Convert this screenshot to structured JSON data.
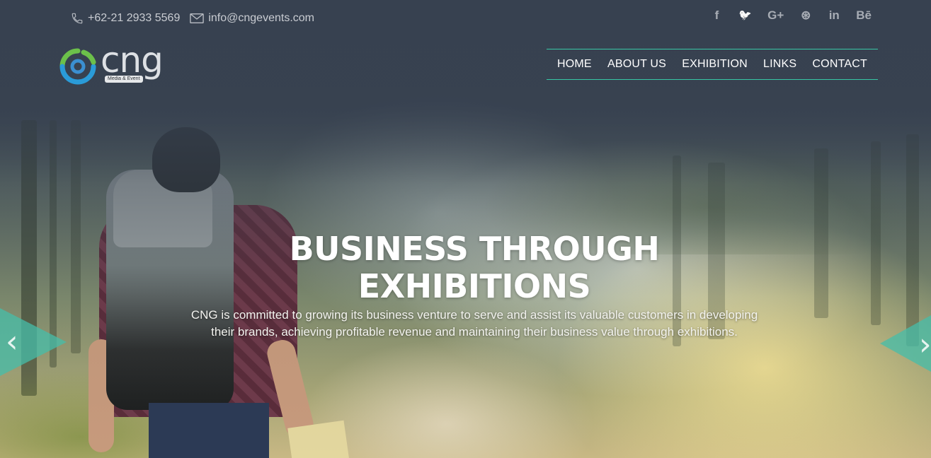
{
  "topbar": {
    "phone": "+62-21 2933 5569",
    "email": "info@cngevents.com",
    "phone_icon": "phone-icon",
    "email_icon": "envelope-icon"
  },
  "social": [
    {
      "icon": "facebook-icon",
      "glyph": "f"
    },
    {
      "icon": "twitter-icon",
      "glyph": "🐦"
    },
    {
      "icon": "google-plus-icon",
      "glyph": "G+"
    },
    {
      "icon": "dribbble-icon",
      "glyph": "⊛"
    },
    {
      "icon": "linkedin-icon",
      "glyph": "in"
    },
    {
      "icon": "behance-icon",
      "glyph": "Bē"
    }
  ],
  "logo": {
    "wordmark": "cng",
    "tagline": "Media & Event"
  },
  "nav": {
    "items": [
      "HOME",
      "ABOUT US",
      "EXHIBITION",
      "LINKS",
      "CONTACT"
    ]
  },
  "hero": {
    "headline_line1": "BUSINESS THROUGH",
    "headline_line2": "EXHIBITIONS",
    "description": "CNG is committed to growing its business venture to serve and assist its valuable customers in developing their brands, achieving profitable revenue and maintaining their business value through exhibitions.",
    "prev_glyph": "‹",
    "next_glyph": "›"
  },
  "colors": {
    "accent": "#37c7a5",
    "header_bg": "#3a4452",
    "logo_green": "#6cc04a",
    "logo_blue": "#2a9bd8"
  }
}
